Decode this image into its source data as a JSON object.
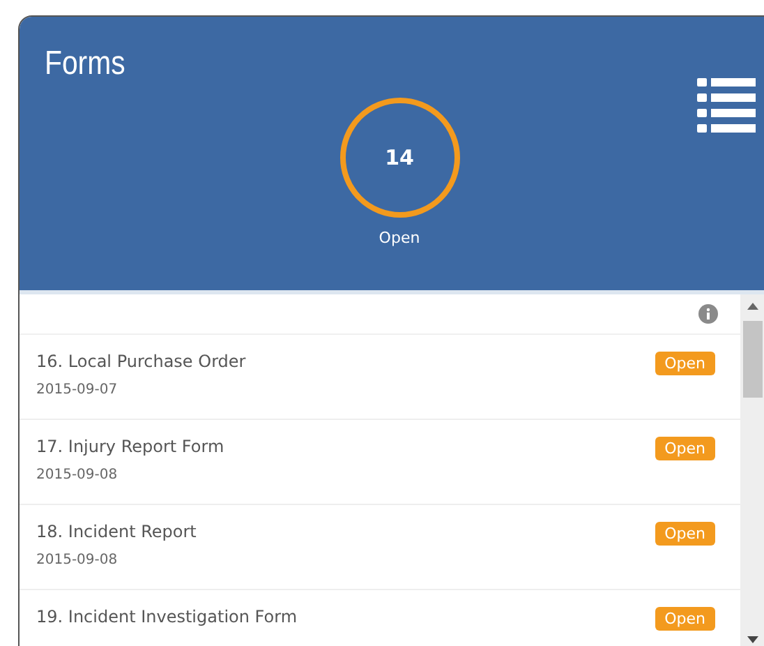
{
  "header": {
    "title": "Forms",
    "count": "14",
    "count_label": "Open"
  },
  "forms": [
    {
      "title": "16. Local Purchase Order",
      "date": "2015-09-07",
      "status": "Open"
    },
    {
      "title": "17. Injury Report Form",
      "date": "2015-09-08",
      "status": "Open"
    },
    {
      "title": "18. Incident Report",
      "date": "2015-09-08",
      "status": "Open"
    },
    {
      "title": "19. Incident Investigation Form",
      "status": "Open"
    }
  ]
}
